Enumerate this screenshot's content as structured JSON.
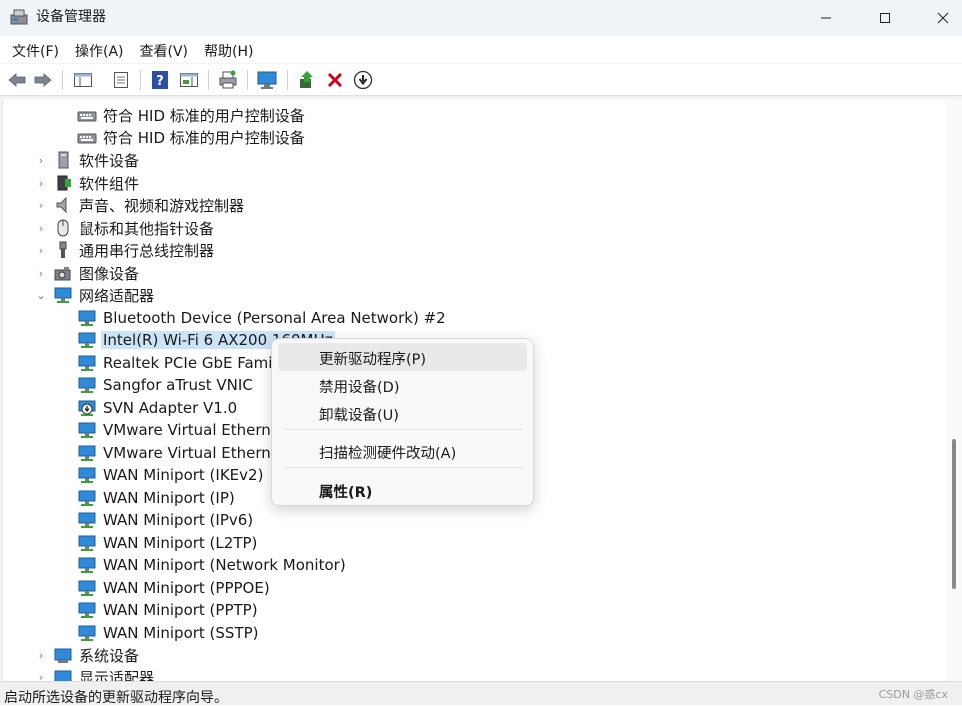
{
  "window": {
    "title": "设备管理器",
    "controls": {
      "minimize": "minimize-icon",
      "maximize": "maximize-icon",
      "close": "close-icon"
    }
  },
  "menubar": [
    {
      "label": "文件(F)"
    },
    {
      "label": "操作(A)"
    },
    {
      "label": "查看(V)"
    },
    {
      "label": "帮助(H)"
    }
  ],
  "toolbar": [
    "back-arrow-icon",
    "forward-arrow-icon",
    "show-hide-console-tree-icon",
    "properties-icon",
    "help-icon",
    "action-pane-icon",
    "print-icon",
    "scan-hardware-icon",
    "update-driver-icon",
    "uninstall-device-icon",
    "disable-device-icon"
  ],
  "tree": {
    "rows": [
      {
        "label": "符合 HID 标准的用户控制设备",
        "level": 2,
        "icon": "hid-device-icon"
      },
      {
        "label": "符合 HID 标准的用户控制设备",
        "level": 2,
        "icon": "hid-device-icon"
      },
      {
        "label": "软件设备",
        "level": 1,
        "icon": "software-device-icon",
        "expander": "collapsed"
      },
      {
        "label": "软件组件",
        "level": 1,
        "icon": "software-component-icon",
        "expander": "collapsed"
      },
      {
        "label": "声音、视频和游戏控制器",
        "level": 1,
        "icon": "speaker-icon",
        "expander": "collapsed"
      },
      {
        "label": "鼠标和其他指针设备",
        "level": 1,
        "icon": "mouse-icon",
        "expander": "collapsed"
      },
      {
        "label": "通用串行总线控制器",
        "level": 1,
        "icon": "usb-icon",
        "expander": "collapsed"
      },
      {
        "label": "图像设备",
        "level": 1,
        "icon": "camera-icon",
        "expander": "collapsed"
      },
      {
        "label": "网络适配器",
        "level": 1,
        "icon": "network-adapter-icon",
        "expander": "expanded"
      },
      {
        "label": "Bluetooth Device (Personal Area Network) #2",
        "level": 2,
        "icon": "network-adapter-icon"
      },
      {
        "label": "Intel(R) Wi-Fi 6 AX200 160MHz",
        "level": 2,
        "icon": "network-adapter-icon",
        "selected": true
      },
      {
        "label": "Realtek PCIe GbE Family Controller",
        "level": 2,
        "icon": "network-adapter-icon"
      },
      {
        "label": "Sangfor aTrust VNIC",
        "level": 2,
        "icon": "network-adapter-icon"
      },
      {
        "label": "SVN Adapter V1.0",
        "level": 2,
        "icon": "network-adapter-warning-icon"
      },
      {
        "label": "VMware Virtual Ethernet Adapter for VMnet1",
        "level": 2,
        "icon": "network-adapter-icon"
      },
      {
        "label": "VMware Virtual Ethernet Adapter for VMnet8",
        "level": 2,
        "icon": "network-adapter-icon"
      },
      {
        "label": "WAN Miniport (IKEv2)",
        "level": 2,
        "icon": "network-adapter-icon"
      },
      {
        "label": "WAN Miniport (IP)",
        "level": 2,
        "icon": "network-adapter-icon"
      },
      {
        "label": "WAN Miniport (IPv6)",
        "level": 2,
        "icon": "network-adapter-icon"
      },
      {
        "label": "WAN Miniport (L2TP)",
        "level": 2,
        "icon": "network-adapter-icon"
      },
      {
        "label": "WAN Miniport (Network Monitor)",
        "level": 2,
        "icon": "network-adapter-icon"
      },
      {
        "label": "WAN Miniport (PPPOE)",
        "level": 2,
        "icon": "network-adapter-icon"
      },
      {
        "label": "WAN Miniport (PPTP)",
        "level": 2,
        "icon": "network-adapter-icon"
      },
      {
        "label": "WAN Miniport (SSTP)",
        "level": 2,
        "icon": "network-adapter-icon"
      },
      {
        "label": "系统设备",
        "level": 1,
        "icon": "system-device-icon",
        "expander": "collapsed"
      },
      {
        "label": "显示适配器",
        "level": 1,
        "icon": "display-adapter-icon",
        "expander": "collapsed"
      }
    ]
  },
  "context_menu": {
    "items": [
      {
        "label": "更新驱动程序(P)",
        "hover": true
      },
      {
        "label": "禁用设备(D)"
      },
      {
        "label": "卸载设备(U)"
      },
      {
        "label": "扫描检测硬件改动(A)"
      },
      {
        "label": "属性(R)",
        "bold": true
      }
    ]
  },
  "statusbar": {
    "text": "启动所选设备的更新驱动程序向导。",
    "watermark": "CSDN @惑cx"
  },
  "colors": {
    "selection": "#cce4f7",
    "titlebar": "#eff4f9",
    "delete_red": "#d0021b",
    "network_icon_blue": "#2f8ad8",
    "network_icon_green": "#37a336"
  }
}
